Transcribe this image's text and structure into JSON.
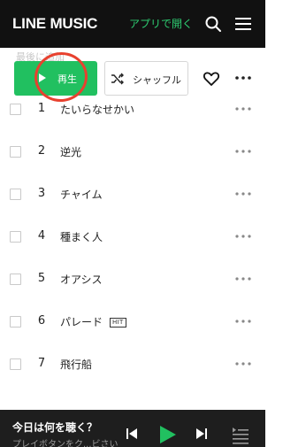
{
  "header": {
    "logo": "LINE MUSIC",
    "open_app": "アプリで開く",
    "search_icon": "search-icon",
    "menu_icon": "hamburger-menu-icon"
  },
  "subrow": {
    "text": "最後に追加"
  },
  "actions": {
    "play_label": "再生",
    "shuffle_label": "シャッフル",
    "heart_icon": "heart-icon",
    "more_icon": "more-horizontal-icon"
  },
  "tracks": [
    {
      "num": "1",
      "title": "たいらなせかい",
      "badge": ""
    },
    {
      "num": "2",
      "title": "逆光",
      "badge": ""
    },
    {
      "num": "3",
      "title": "チャイム",
      "badge": ""
    },
    {
      "num": "4",
      "title": "種まく人",
      "badge": ""
    },
    {
      "num": "5",
      "title": "オアシス",
      "badge": ""
    },
    {
      "num": "6",
      "title": "パレード",
      "badge": "HIT"
    },
    {
      "num": "7",
      "title": "飛行船",
      "badge": ""
    }
  ],
  "player": {
    "title": "今日は何を聴く？",
    "subtitle": "プレイボタンをク...ビさい"
  },
  "colors": {
    "accent_green": "#21c060",
    "header_bg": "#111111",
    "player_bg": "#1e1e1e",
    "annotation_red": "#e8412f"
  }
}
